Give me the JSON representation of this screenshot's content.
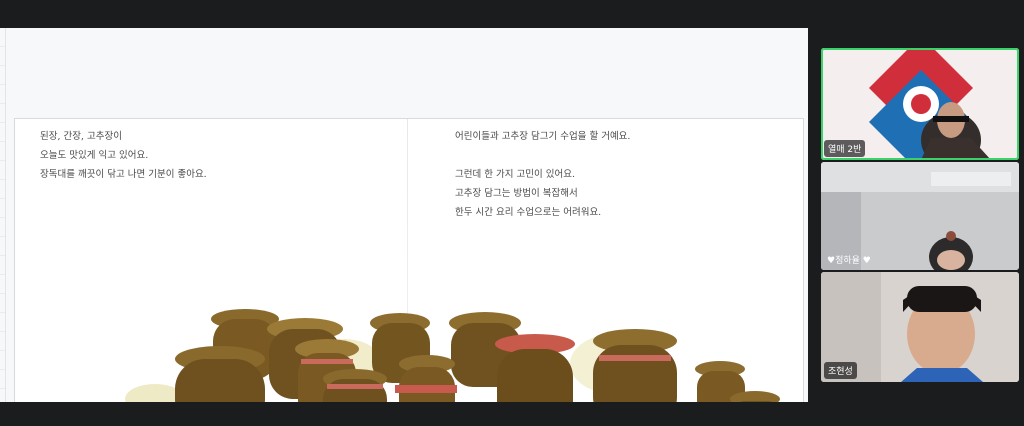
{
  "shared_screen": {
    "left_page": [
      "된장, 간장, 고추장이",
      "오늘도 맛있게 익고 있어요.",
      "장독대를 깨끗이 닦고 나면 기분이 좋아요."
    ],
    "right_page": [
      "어린이들과 고추장 담그기 수업을 할 거예요.",
      "",
      "그런데 한 가지 고민이 있어요.",
      "고추장 담그는 방법이 복잡해서",
      "한두 시간 요리 수업으로는 어려워요."
    ],
    "illustration_icon": "onggi-jars-illustration"
  },
  "participants": [
    {
      "name": "열매 2반",
      "active": true,
      "icon": "user-video"
    },
    {
      "name": "♥정하율 ♥",
      "active": false,
      "icon": "user-video"
    },
    {
      "name": "조현성",
      "active": false,
      "icon": "user-video"
    }
  ],
  "colors": {
    "background": "#1b1c1e",
    "active_speaker": "#3ad36a",
    "page": "#ffffff",
    "text": "#4a4a4a"
  }
}
